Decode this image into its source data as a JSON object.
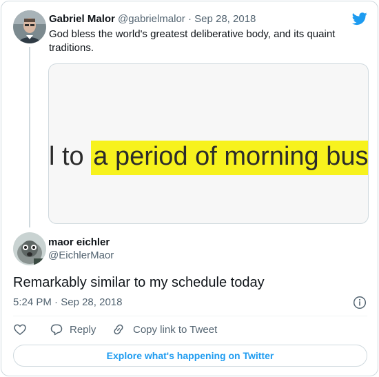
{
  "tweet1": {
    "author_name": "Gabriel Malor",
    "author_handle": "@gabrielmalor",
    "separator": "·",
    "date": "Sep 28, 2018",
    "text": "God bless the world's greatest deliberative body, and its quaint traditions.",
    "media": {
      "prefix_text": "l to ",
      "highlighted_text": "a period of morning busin"
    }
  },
  "tweet2": {
    "author_name": "maor eichler",
    "author_handle": "@EichlerMaor",
    "text": "Remarkably similar to my schedule today",
    "time": "5:24 PM",
    "separator": "·",
    "date": "Sep 28, 2018"
  },
  "actions": {
    "reply_label": "Reply",
    "copy_label": "Copy link to Tweet"
  },
  "explore": {
    "label": "Explore what's happening on Twitter"
  },
  "colors": {
    "twitter_blue": "#1d9bf0",
    "highlight_yellow": "#f7f21d",
    "muted_text": "#536471",
    "border": "#cfd9de"
  },
  "icons": [
    "twitter-bird-icon",
    "info-icon",
    "heart-icon",
    "reply-bubble-icon",
    "link-icon"
  ]
}
